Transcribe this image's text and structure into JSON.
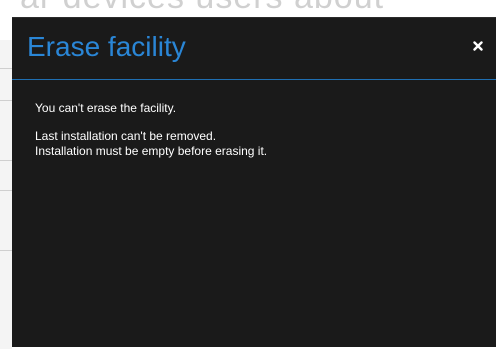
{
  "background": {
    "partial_text": "ar devices users about"
  },
  "dialog": {
    "title": "Erase facility",
    "close_icon": "close-icon",
    "message_primary": "You can't erase the facility.",
    "message_line_1": "Last installation can't be removed.",
    "message_line_2": "Installation must be empty before erasing it."
  },
  "colors": {
    "dialog_background": "#1a1a1a",
    "title": "#2a86d6",
    "header_divider": "#1f6fb2",
    "body_text": "#ffffff",
    "close_icon": "#ffffff"
  }
}
